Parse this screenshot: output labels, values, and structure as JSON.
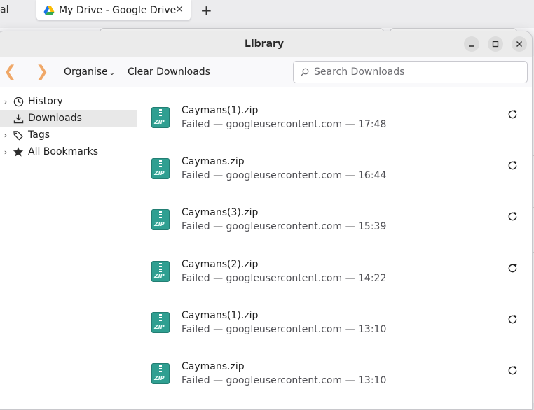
{
  "browser": {
    "edge_text": "al",
    "tab_title": "My Drive - Google Drive",
    "tab_close": "✕",
    "new_tab": "+"
  },
  "window": {
    "title": "Library",
    "minimize": "—",
    "maximize": "□",
    "close": "✕"
  },
  "toolbar": {
    "back": "❮",
    "forward": "❯",
    "organise": "Organise",
    "clear_downloads": "Clear Downloads",
    "search_placeholder": "Search Downloads"
  },
  "sidebar": {
    "items": [
      {
        "label": "History",
        "icon": "clock-icon",
        "expandable": true,
        "selected": false
      },
      {
        "label": "Downloads",
        "icon": "download-icon",
        "expandable": false,
        "selected": true
      },
      {
        "label": "Tags",
        "icon": "tag-icon",
        "expandable": true,
        "selected": false
      },
      {
        "label": "All Bookmarks",
        "icon": "star-icon",
        "expandable": true,
        "selected": false
      }
    ]
  },
  "downloads": [
    {
      "name": "Caymans(1).zip",
      "status": "Failed — googleusercontent.com — 17:48"
    },
    {
      "name": "Caymans.zip",
      "status": "Failed — googleusercontent.com — 16:44"
    },
    {
      "name": "Caymans(3).zip",
      "status": "Failed — googleusercontent.com — 15:39"
    },
    {
      "name": "Caymans(2).zip",
      "status": "Failed — googleusercontent.com — 14:22"
    },
    {
      "name": "Caymans(1).zip",
      "status": "Failed — googleusercontent.com — 13:10"
    },
    {
      "name": "Caymans.zip",
      "status": "Failed — googleusercontent.com — 13:10"
    }
  ],
  "zip_icon_label": "ZIP",
  "colors": {
    "zip_icon": "#2f9f91",
    "nav_arrow": "#f0a868",
    "selected_row": "#e8e8e8"
  }
}
